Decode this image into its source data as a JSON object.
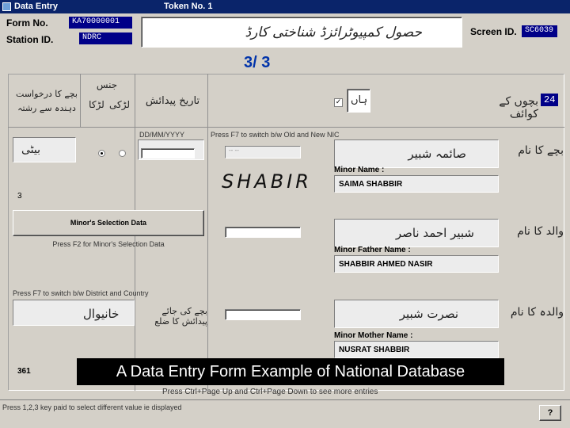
{
  "window": {
    "title": "Data Entry",
    "token": "Token No. 1"
  },
  "header": {
    "form_no_label": "Form No.",
    "form_no_value": "KA70000001",
    "station_id_label": "Station ID.",
    "station_id_value": "NDRC",
    "form_title_urdu": "حصول کمپیوٹرائزڈ شناختی کارڈ",
    "screen_id_label": "Screen ID.",
    "screen_id_value": "SC6039"
  },
  "page_indicator": "3/ 3",
  "columns": {
    "applicant_relation": "بچے کا درخواست دہندہ سے رشتہ",
    "gender": "جنس",
    "boy": "لڑکا",
    "girl": "لڑکی",
    "dob": "تاریخ پیدائش",
    "yes": "ہاں",
    "children_details": "بچوں کے کوائف",
    "children_count": "24"
  },
  "row": {
    "relation_value": "بیٹی",
    "dob_format": "DD/MM/YYYY",
    "nic_switch_hint": "Press F7 to switch b/w Old and New NIC",
    "nic_placeholder": "-- --",
    "handwritten_name": "SHABIR",
    "row_number": "3",
    "child_name_label": "بچے کا نام",
    "child_name_urdu": "صائمہ شبیر",
    "minor_name_label": "Minor Name :",
    "minor_name_value": "SAIMA SHABBIR",
    "father_name_label": "والد کا نام",
    "father_name_urdu": "شبیر احمد ناصر",
    "minor_father_label": "Minor Father Name :",
    "minor_father_value": "SHABBIR AHMED NASIR",
    "mother_name_label": "والدہ کا نام",
    "mother_name_urdu": "نصرت شبیر",
    "minor_mother_label": "Minor Mother Name :",
    "minor_mother_value": "NUSRAT SHABBIR",
    "birthplace_label": "بچے کی جائے پیدائش کا ضلع",
    "birthplace_value": "خانیوال",
    "district_switch_hint": "Press F7 to switch b/w District and Country",
    "district_code": "361"
  },
  "minor_selection": {
    "button_label": "Minor's Selection Data",
    "hint": "Press F2 for Minor's Selection Data"
  },
  "footer": {
    "page_nav_hint": "Press Ctrl+Page Up and Ctrl+Page Down to see more entries",
    "status_text": "Press 1,2,3 key paid to select different value ie displayed",
    "help_label": "?"
  },
  "caption": "A Data Entry Form Example of National Database"
}
